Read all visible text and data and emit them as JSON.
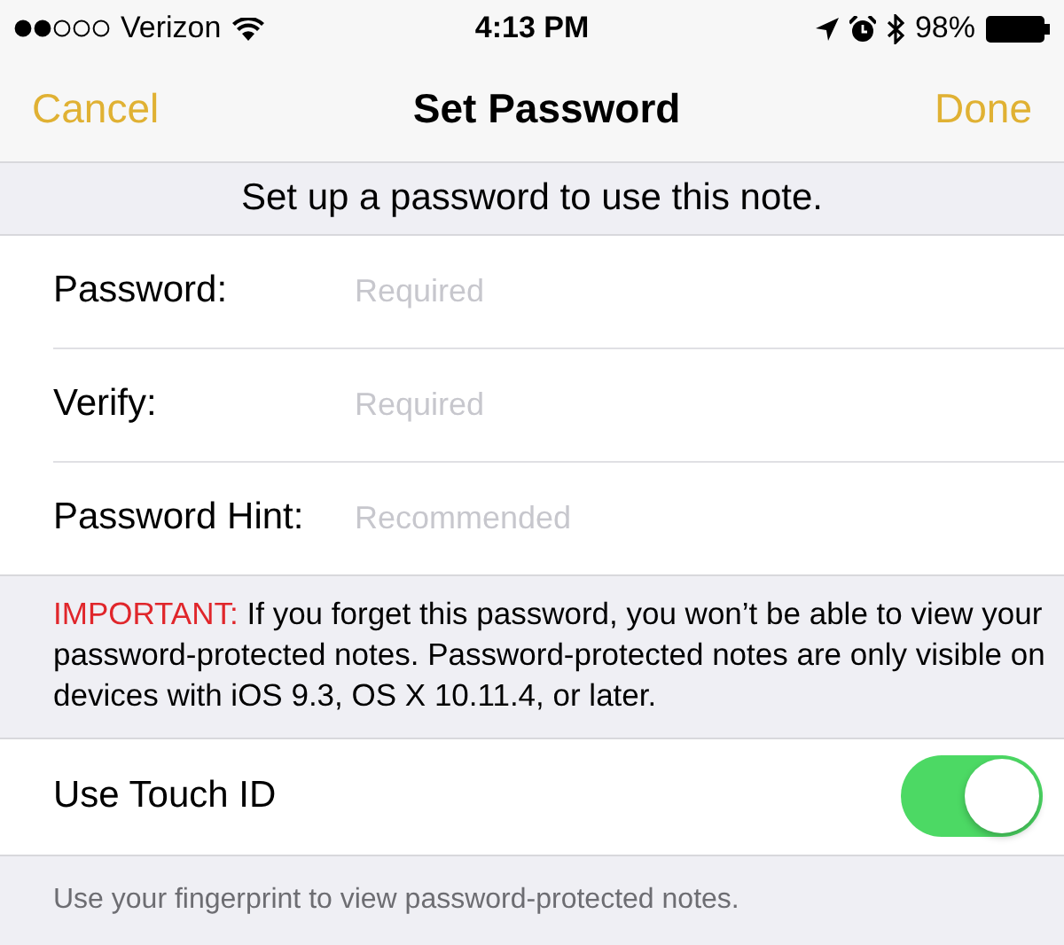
{
  "status_bar": {
    "carrier": "Verizon",
    "time": "4:13 PM",
    "battery": "98%"
  },
  "nav": {
    "cancel": "Cancel",
    "title": "Set Password",
    "done": "Done"
  },
  "header": "Set up a password to use this note.",
  "fields": [
    {
      "label": "Password:",
      "placeholder": "Required"
    },
    {
      "label": "Verify:",
      "placeholder": "Required"
    },
    {
      "label": "Password Hint:",
      "placeholder": "Recommended"
    }
  ],
  "warning": {
    "label": "IMPORTANT:",
    "text": "If you forget this password, you won’t be able to view your password-protected notes. Password-protected notes are only visible on devices with iOS 9.3, OS X 10.11.4, or later."
  },
  "touch_id": {
    "label": "Use Touch ID",
    "on": true
  },
  "footer": "Use your fingerprint to view password-protected notes."
}
